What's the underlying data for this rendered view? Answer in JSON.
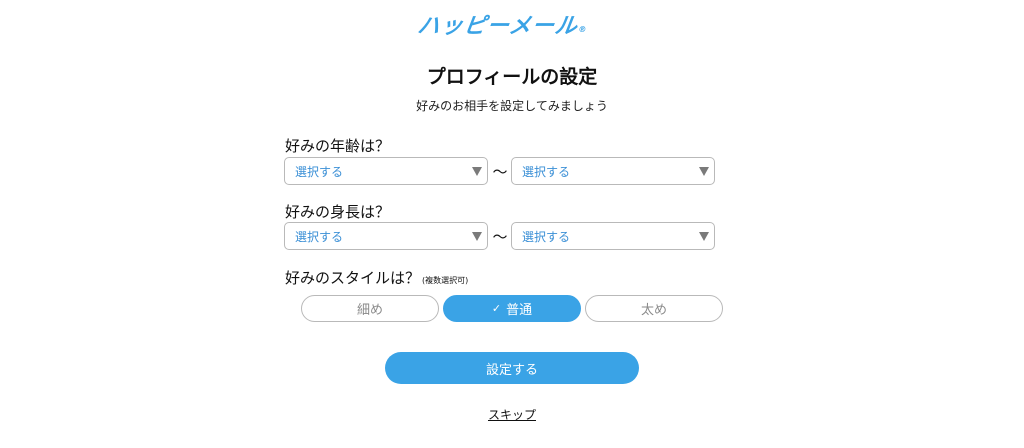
{
  "brand": {
    "logo_text": "ハッピーメール",
    "logo_mark": "®",
    "color": "#3aa3e6"
  },
  "header": {
    "title": "プロフィールの設定",
    "subtitle": "好みのお相手を設定してみましょう"
  },
  "age": {
    "label": "好みの年齢は？",
    "from_value": "選択する",
    "separator": "〜",
    "to_value": "選択する"
  },
  "height": {
    "label": "好みの身長は？",
    "from_value": "選択する",
    "separator": "〜",
    "to_value": "選択する"
  },
  "style": {
    "label": "好みのスタイルは？",
    "note": "(複数選択可)",
    "options": [
      {
        "label": "細め",
        "selected": false
      },
      {
        "label": "普通",
        "selected": true,
        "check": "✓"
      },
      {
        "label": "太め",
        "selected": false
      }
    ]
  },
  "actions": {
    "submit_label": "設定する",
    "skip_label": "スキップ"
  },
  "icons": {
    "dropdown": "chevron-down-icon",
    "selected": "check-icon"
  }
}
